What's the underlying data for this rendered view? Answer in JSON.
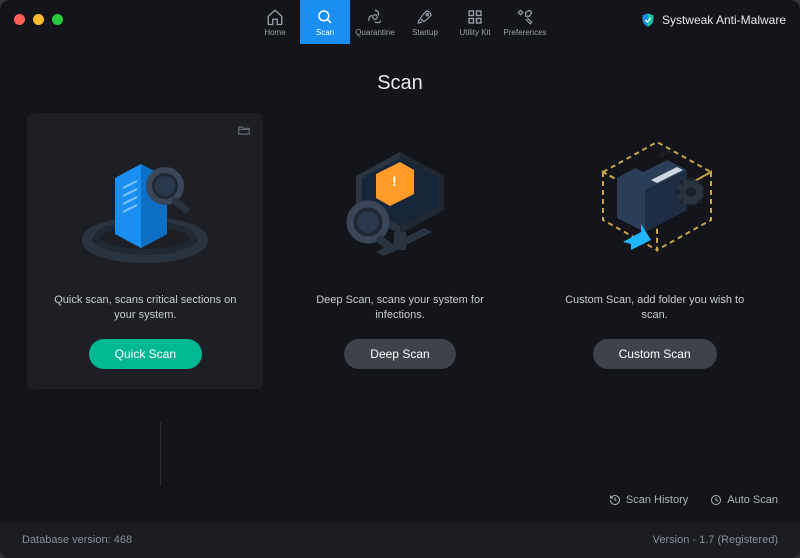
{
  "brand": {
    "name": "Systweak Anti-Malware"
  },
  "toolbar": {
    "home": "Home",
    "scan": "Scan",
    "quarantine": "Quarantine",
    "startup": "Startup",
    "utility": "Utility Kit",
    "preferences": "Preferences"
  },
  "page": {
    "title": "Scan"
  },
  "cards": {
    "quick": {
      "desc": "Quick scan, scans critical sections on your system.",
      "button": "Quick Scan"
    },
    "deep": {
      "desc": "Deep Scan, scans your system for infections.",
      "button": "Deep Scan"
    },
    "custom": {
      "desc": "Custom Scan, add folder you wish to scan.",
      "button": "Custom Scan"
    }
  },
  "footer": {
    "scan_history": "Scan History",
    "auto_scan": "Auto Scan"
  },
  "status": {
    "db_label": "Database version: 468",
    "version_label": "Version  -  1.7 (Registered)"
  }
}
